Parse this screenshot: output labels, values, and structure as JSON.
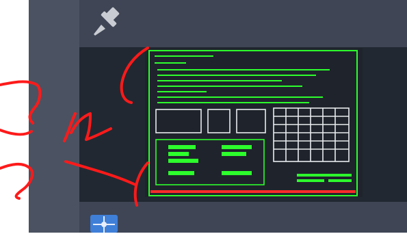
{
  "window": {
    "pin_icon": "pushpin-icon",
    "bottom_icon": "drawing-target-icon"
  },
  "thumbnail": {
    "description_role": "cad-drawing-preview",
    "frame_color": "#2dff2d",
    "title_block_color": "#ff2a2a",
    "text_line_count": 11
  },
  "annotation": {
    "ink_color": "#ff1a1a",
    "note_text": "2 L"
  },
  "colors": {
    "panel_dark": "#222831",
    "panel_mid": "#3f4555",
    "side_strip": "#4b5261",
    "accent_icon": "#3f7fd8"
  }
}
